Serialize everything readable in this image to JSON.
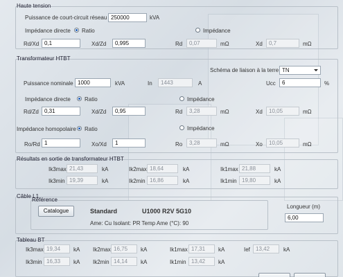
{
  "haute_tension": {
    "title": "Haute tension",
    "pcc_label": "Puissance de court-circuit réseau",
    "pcc_value": "250000",
    "pcc_unit": "kVA",
    "imp_directe_label": "Impédance directe",
    "ratio_label": "Ratio",
    "impedance_label": "Impédance",
    "rdxd_label": "Rd/Xd",
    "rdxd_value": "0,1",
    "xdzd_label": "Xd/Zd",
    "xdzd_value": "0,995",
    "rd_label": "Rd",
    "rd_value": "0,07",
    "rd_unit": "mΩ",
    "xd_label": "Xd",
    "xd_value": "0,7",
    "xd_unit": "mΩ"
  },
  "transfo": {
    "title": "Transformateur HTBT",
    "schema_label": "Schéma de liaison à la terre",
    "schema_value": "TN",
    "pn_label": "Puissance nominale",
    "pn_value": "1000",
    "pn_unit": "kVA",
    "in_label": "In",
    "in_value": "1443",
    "in_unit": "A",
    "ucc_label": "Ucc",
    "ucc_value": "6",
    "ucc_unit": "%",
    "imp_directe_label": "Impédance directe",
    "ratio_label": "Ratio",
    "impedance_label": "Impédance",
    "rdzd_label": "Rd/Zd",
    "rdzd_value": "0,31",
    "xdzd_label": "Xd/Zd",
    "xdzd_value": "0,95",
    "rd_label": "Rd",
    "rd_value": "3,28",
    "rd_unit": "mΩ",
    "xd_label": "Xd",
    "xd_value": "10,05",
    "xd_unit": "mΩ",
    "imp_homo_label": "Impédance homopolaire",
    "ratio2_label": "Ratio",
    "impedance2_label": "Impédance",
    "roxd_label": "Ro/Rd",
    "roxd_value": "1",
    "xoxd_label": "Xo/Xd",
    "xoxd_value": "1",
    "ro_label": "Ro",
    "ro_value": "3,28",
    "ro_unit": "mΩ",
    "xo_label": "Xo",
    "xo_value": "10,05",
    "xo_unit": "mΩ"
  },
  "resultats": {
    "title": "Résultats en sortie de transformateur HTBT",
    "rows": [
      [
        {
          "label": "Ik3max",
          "value": "21,43",
          "unit": "kA"
        },
        {
          "label": "Ik2max",
          "value": "18,64",
          "unit": "kA"
        },
        {
          "label": "Ik1max",
          "value": "21,88",
          "unit": "kA"
        }
      ],
      [
        {
          "label": "Ik3min",
          "value": "19,39",
          "unit": "kA"
        },
        {
          "label": "Ik2min",
          "value": "16,86",
          "unit": "kA"
        },
        {
          "label": "Ik1min",
          "value": "19,80",
          "unit": "kA"
        }
      ]
    ]
  },
  "cable": {
    "title": "Câble L1",
    "reference_label": "Référence",
    "catalogue_button": "Catalogue",
    "type": "Standard",
    "name": "U1000 R2V 5G10",
    "details": "Ame: Cu   Isolant: PR   Temp Ame (°C): 90",
    "longueur_label": "Longueur (m)",
    "longueur_value": "6,00"
  },
  "tableau": {
    "title": "Tableau BT",
    "rows": [
      [
        {
          "label": "Ik3max",
          "value": "19,34",
          "unit": "kA"
        },
        {
          "label": "Ik2max",
          "value": "16,75",
          "unit": "kA"
        },
        {
          "label": "Ik1max",
          "value": "17,31",
          "unit": "kA"
        },
        {
          "label": "Ief",
          "value": "13,42",
          "unit": "kA"
        }
      ],
      [
        {
          "label": "Ik3min",
          "value": "16,33",
          "unit": "kA"
        },
        {
          "label": "Ik2min",
          "value": "14,14",
          "unit": "kA"
        },
        {
          "label": "Ik1min",
          "value": "13,42",
          "unit": "kA"
        }
      ]
    ]
  }
}
